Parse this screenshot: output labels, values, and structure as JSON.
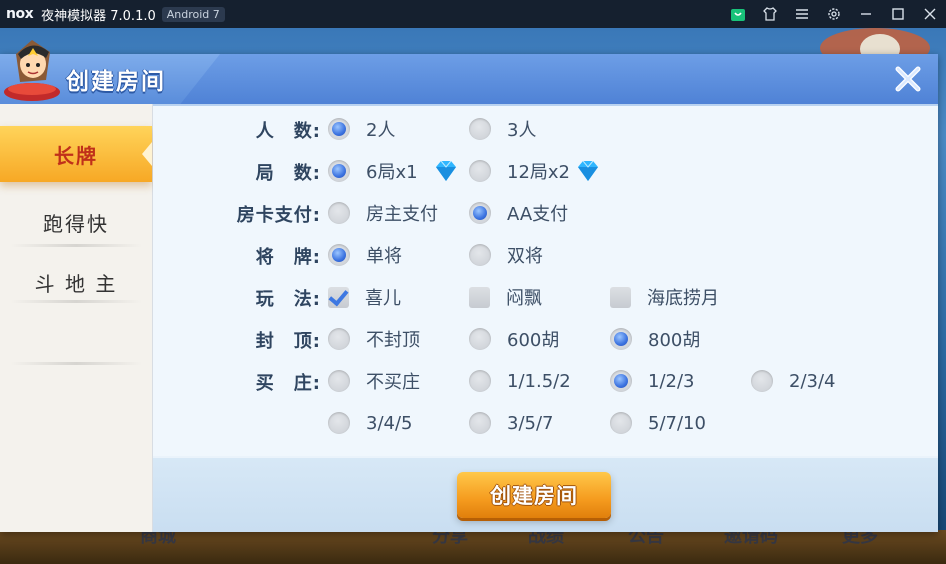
{
  "window": {
    "logo": "nox",
    "title": "夜神模拟器 7.0.1.0",
    "android_badge": "Android 7",
    "icons": [
      "store-icon",
      "shirt-icon",
      "menu-icon",
      "settings-icon",
      "minimize-icon",
      "maximize-icon",
      "close-icon"
    ]
  },
  "background_labels": {
    "mall": "商城",
    "share": "分享",
    "record": "战绩",
    "notice": "公告",
    "invite": "邀请码",
    "more": "更多"
  },
  "dialog": {
    "title": "创建房间",
    "close_icon": "close-x-icon",
    "menu": [
      {
        "label": "长牌",
        "active": true
      },
      {
        "label": "跑得快",
        "active": false
      },
      {
        "label": "斗 地 主",
        "active": false
      }
    ],
    "rows": [
      {
        "label": "人　数:",
        "options": [
          {
            "text": "2人",
            "type": "radio",
            "checked": true
          },
          {
            "text": "3人",
            "type": "radio",
            "checked": false
          }
        ]
      },
      {
        "label": "局　数:",
        "options": [
          {
            "text": "6局x1",
            "type": "radio",
            "checked": true,
            "icon": "diamond-icon"
          },
          {
            "text": "12局x2",
            "type": "radio",
            "checked": false,
            "icon": "diamond-icon"
          }
        ]
      },
      {
        "label": "房卡支付:",
        "options": [
          {
            "text": "房主支付",
            "type": "radio",
            "checked": false
          },
          {
            "text": "AA支付",
            "type": "radio",
            "checked": true
          }
        ]
      },
      {
        "label": "将　牌:",
        "options": [
          {
            "text": "单将",
            "type": "radio",
            "checked": true
          },
          {
            "text": "双将",
            "type": "radio",
            "checked": false
          }
        ]
      },
      {
        "label": "玩　法:",
        "options": [
          {
            "text": "喜儿",
            "type": "checkbox",
            "checked": true
          },
          {
            "text": "闷飘",
            "type": "checkbox",
            "checked": false
          },
          {
            "text": "海底捞月",
            "type": "checkbox",
            "checked": false
          }
        ]
      },
      {
        "label": "封　顶:",
        "options": [
          {
            "text": "不封顶",
            "type": "radio",
            "checked": false
          },
          {
            "text": "600胡",
            "type": "radio",
            "checked": false
          },
          {
            "text": "800胡",
            "type": "radio",
            "checked": true
          }
        ]
      },
      {
        "label": "买　庄:",
        "options": [
          {
            "text": "不买庄",
            "type": "radio",
            "checked": false
          },
          {
            "text": "1/1.5/2",
            "type": "radio",
            "checked": false
          },
          {
            "text": "1/2/3",
            "type": "radio",
            "checked": true
          },
          {
            "text": "2/3/4",
            "type": "radio",
            "checked": false
          }
        ]
      },
      {
        "label": "",
        "options": [
          {
            "text": "3/4/5",
            "type": "radio",
            "checked": false
          },
          {
            "text": "3/5/7",
            "type": "radio",
            "checked": false
          },
          {
            "text": "5/7/10",
            "type": "radio",
            "checked": false
          }
        ]
      }
    ],
    "create_button": "创建房间"
  },
  "colors": {
    "header_blue": "#4f82d6",
    "active_tab_gold": "#f7a825",
    "radio_blue": "#3c73e0",
    "button_orange": "#f59b1e"
  }
}
